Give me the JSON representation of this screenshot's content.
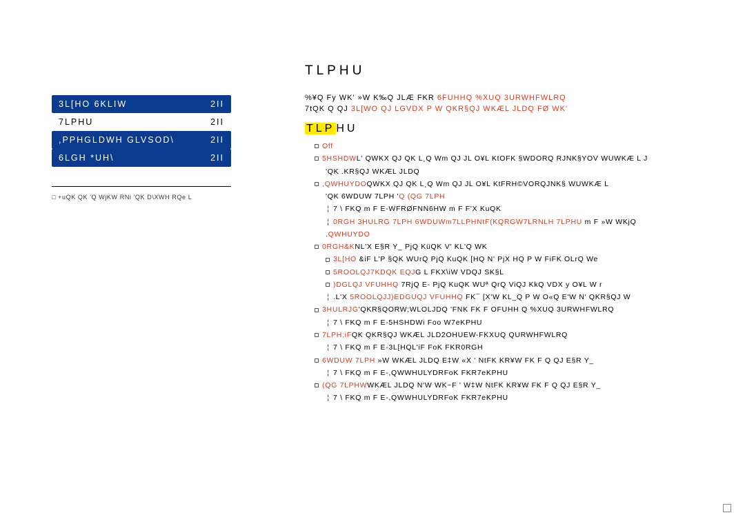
{
  "sidebar": {
    "items": [
      {
        "label": "3L[HO 6KLIW",
        "status": "2II"
      },
      {
        "label": "7LPHU",
        "status": "2II"
      },
      {
        "label": ",PPHGLDWH GLVSOD\\",
        "status": "2II"
      },
      {
        "label": "6LGH *UH\\",
        "status": "2II"
      }
    ],
    "footer": "□ +uQK QK 'Q WjKW RNi 'QK D\\XWH RQe L"
  },
  "main": {
    "title": "TLPHU",
    "desc1_a": "%¥Q Fy WK' »W K‰Q JLÆ FKR ",
    "desc1_b": "6FUHHQ %XUQ 3URWHFWLRQ",
    "desc2_a": "7tQK Q QJ ",
    "desc2_b": "3L[WO QJ LGVDX P W QKR§QJ WKÆL JLDQ FØ WK'",
    "subtitle_a": "TLP",
    "subtitle_b": "HU"
  },
  "content": {
    "l0": "Off",
    "l1_a": "5HSHDW",
    "l1_b": "L' QWKX QJ QK L¸Q Wm QJ JL O¥L KtOFK §WDORQ RJNK§YOV WUWKÆ L J",
    "l1_c": "'QK  .KR§QJ WKÆL JLDQ",
    "l2_a": ",QWHUYDO",
    "l2_b": "QWKX QJ QK L¸Q Wm QJ JL O¥L KtFRH©VORQJNK§ WUWKÆ L",
    "l2_c": "'QK 6WDUW 7LPH '",
    "l2_d": "Q (QG 7LPH",
    "l3_a": "7 \\ FKQ  m F E-WFRØFNN6HW",
    "l3_b": "m F F'X KuQK",
    "l4_a": "0RGH 3HULRG 7LPH 6WDUWm7LLPHNtF(KQRGW7LRNLH 7LPHU",
    "l4_b": "m F  »W WKjQ",
    "l4_c": ",QWHUYDO",
    "l5_a": "0RGH&K",
    "l5_b": "NL'X E§R Y_ PjQ KüQK V' KL'Q WK",
    "l6_a": "3L[HO",
    "l6_b": "&iF L'P §QK WUrQ PjQ KuQK [HQ N' PjX  HQ P W FiFK OLrQ We",
    "l7_a": "5ROOLQJ7KDQK EQJ",
    "l7_b": "G L FKX\\iW VDQJ SK§L",
    "l8_a": ")DGLQJ VFUHHQ",
    "l8_b": "7RjQ E- PjQ KuQK WUª QrQ ViQJ KkQ  VDX   y O¥L W r",
    "l9_a": ".L'X ",
    "l9_b": "5ROOLQJJ)EDGUQJ VFUHHQ",
    "l9_c": "FK¯ [X'W KL_Q P W O«Q E'W N' QKR§QJ W",
    "l10_a": "3HULRJG",
    "l10_b": "'QKR§QORW;WLOLJDQ 'FNK FK F OFUHH Q %XUQ 3URWHFWLRQ",
    "l11_a": "7 \\ FKQ  m F E-5HSHDWi Foo W7eKPHU",
    "l12_a": "7LPH;iF",
    "l12_b": "QK QKR§QJ WKÆL JLD2OHUEW-FKXUQ QURWHFWLRQ",
    "l13_a": "7 \\ FKQ  m F E-3L[HQL'iF FoK FKR0RGH",
    "l14_a": "6WDUW 7LPH",
    "l14_b": "»W WKÆL JLDQ E‡W  «X ' NtFK KR¥W FK F Q QJ E§R Y_",
    "l15_a": "7 \\ FKQ  m F E-,QWWHULYDRFoK FKR7eKPHU",
    "l16_a": "(QG 7LPHW",
    "l16_b": "WKÆL JLDQ N'W WK~F ' W‡W NtFK KR¥W FK F Q QJ E§R Y_",
    "l17_a": "7 \\ FKQ  m F E-,QWWHULYDRFoK FKR7eKPHU"
  }
}
